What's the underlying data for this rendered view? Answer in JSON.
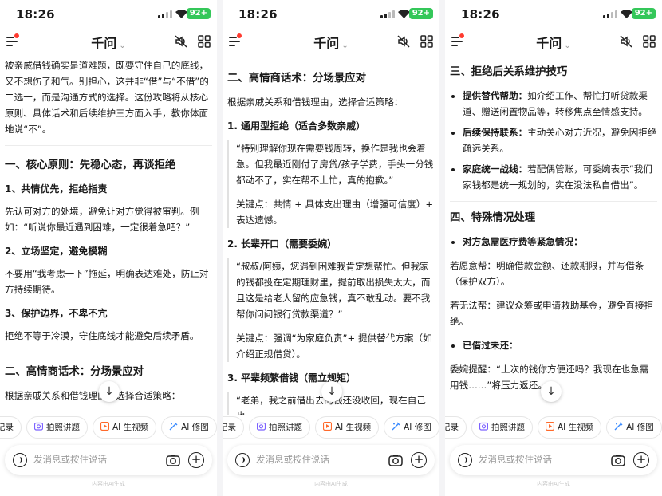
{
  "status": {
    "time": "18:26",
    "battery": "92+"
  },
  "header": {
    "title": "千问",
    "chev": "⌄"
  },
  "screen1": {
    "intro": "被亲戚借钱确实是道难题，既要守住自己的底线，又不想伤了和气。别担心，这并非“借”与“不借”的二选一，而是沟通方式的选择。这份攻略将从核心原则、具体话术和后续维护三方面入手，教你体面地说“不”。",
    "h_core": "一、核心原则：先稳心态，再谈拒绝",
    "s1_title": "1、共情优先，拒绝指责",
    "s1_body": "先认可对方的处境，避免让对方觉得被审判。例如：“听说你最近遇到困难，一定很着急吧？”",
    "s2_title": "2、立场坚定，避免模糊",
    "s2_body": "不要用“我考虑一下”拖延，明确表达难处，防止对方持续期待。",
    "s3_title": "3、保护边界，不卑不亢",
    "s3_body": "拒绝不等于冷漠，守住底线才能避免后续矛盾。",
    "h_script": "二、高情商话术：分场景应对",
    "tail": "根据亲戚关系和借钱理由，选择合适策略："
  },
  "screen2": {
    "h_script": "二、高情商话术：分场景应对",
    "lead": "根据亲戚关系和借钱理由，选择合适策略：",
    "t1": "1. 通用型拒绝（适合多数亲戚）",
    "q1": "“特别理解你现在需要钱周转，换作是我也会着急。但我最近刚付了房贷/孩子学费，手头一分钱都动不了，实在帮不上忙，真的抱歉。”",
    "k1": "关键点：共情 + 具体支出理由（增强可信度）+ 表达遗憾。",
    "t2": "2. 长辈开口（需要委婉）",
    "q2": "“叔叔/阿姨，您遇到困难我肯定想帮忙。但我家的钱都投在定期理财里，提前取出损失太大，而且这是给老人留的应急钱，真不敢乱动。要不我帮你问问银行贷款渠道？”",
    "k2": "关键点：强调“为家庭负责”+ 提供替代方案（如介绍正规借贷）。",
    "t3": "3. 平辈频繁借钱（需立规矩）",
    "q3": "“老弟，我之前借出去的钱还没收回，现在自己也"
  },
  "screen3": {
    "h3": "三、拒绝后关系维护技巧",
    "l1b": "提供替代帮助：",
    "l1": "如介绍工作、帮忙打听贷款渠道、赠送闲置物品等，转移焦点至情感支持。",
    "l2b": "后续保持联系：",
    "l2": "主动关心对方近况，避免因拒绝疏远关系。",
    "l3b": "家庭统一战线：",
    "l3": "若配偶管账，可委婉表示“我们家钱都是统一规划的，实在没法私自借出”。",
    "h4": "四、特殊情况处理",
    "b1": "对方急需医疗费等紧急情况：",
    "p1": "若愿意帮：明确借款金额、还款期限，并写借条（保护双方）。",
    "p2": "若无法帮：建议众筹或申请救助基金，避免直接拒绝。",
    "b2": "已借过未还：",
    "p3": "委婉提醒：“上次的钱你方便还吗？我现在也急需用钱……”将压力返还。"
  },
  "chips": {
    "record": "记录",
    "photo": "拍照讲题",
    "video": "AI 生视频",
    "retouch": "AI 修图"
  },
  "input": {
    "placeholder": "发消息或按住说话"
  },
  "footnote": "内容由AI生成",
  "colors": {
    "accent_red": "#ff3b30",
    "battery_green": "#34c759"
  }
}
